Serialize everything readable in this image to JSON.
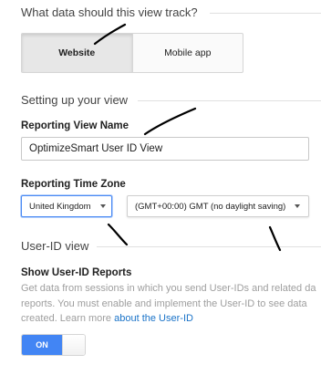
{
  "track": {
    "question": "What data should this view track?",
    "options": [
      "Website",
      "Mobile app"
    ],
    "selected": "Website"
  },
  "setup": {
    "title": "Setting up your view",
    "view_name_label": "Reporting View Name",
    "view_name_value": "OptimizeSmart User ID View",
    "time_zone_label": "Reporting Time Zone",
    "country_value": "United Kingdom",
    "zone_value": "(GMT+00:00) GMT (no daylight saving)"
  },
  "userid": {
    "title": "User-ID view",
    "reports_label": "Show User-ID Reports",
    "desc_line1": "Get data from sessions in which you send User-IDs and related da",
    "desc_line2": "reports. You must enable and implement the User-ID to see data",
    "desc_line3": "created. Learn more ",
    "learn_link": "about the User-ID",
    "toggle_label": "ON",
    "toggle_state": "on"
  },
  "colors": {
    "accent": "#4285f4",
    "link": "#1a73c8",
    "annotation": "#000000"
  },
  "icons": {
    "dropdown": "chevron-down-icon"
  }
}
